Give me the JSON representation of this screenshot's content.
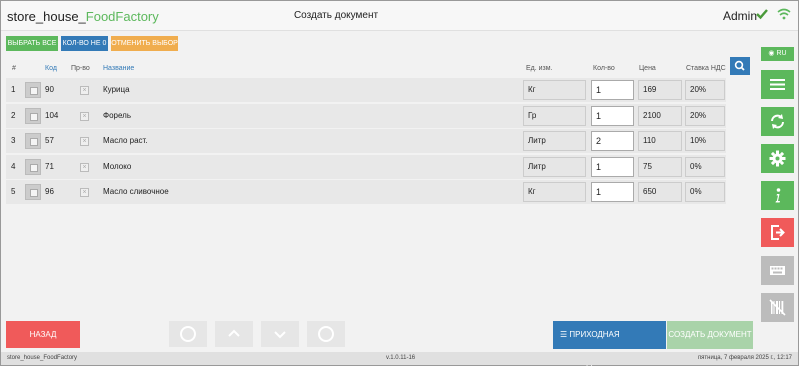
{
  "header": {
    "brand_prefix": "store_house_",
    "brand_suffix": "FoodFactory",
    "title": "Создать документ",
    "user": "Admin"
  },
  "toolbar": {
    "select_all": "ВЫБРАТЬ ВСЕ",
    "qty_zero": "КОЛ-ВО НЕ 0",
    "cancel_selection": "ОТМЕНИТЬ ВЫБОР"
  },
  "table": {
    "headers": {
      "num": "#",
      "code": "Код",
      "producer": "Пр-во",
      "name": "Название",
      "unit": "Ед. изм.",
      "qty": "Кол-во",
      "price": "Цена",
      "vat": "Ставка НДС"
    },
    "rows": [
      {
        "num": "1",
        "code": "90",
        "name": "Курица",
        "unit": "Кг",
        "qty": "1",
        "price": "169",
        "vat": "20%"
      },
      {
        "num": "2",
        "code": "104",
        "name": "Форель",
        "unit": "Гр",
        "qty": "1",
        "price": "2100",
        "vat": "20%"
      },
      {
        "num": "3",
        "code": "57",
        "name": "Масло раст.",
        "unit": "Литр",
        "qty": "2",
        "price": "110",
        "vat": "10%"
      },
      {
        "num": "4",
        "code": "71",
        "name": "Молоко",
        "unit": "Литр",
        "qty": "1",
        "price": "75",
        "vat": "0%"
      },
      {
        "num": "5",
        "code": "96",
        "name": "Масло сливочное",
        "unit": "Кг",
        "qty": "1",
        "price": "650",
        "vat": "0%"
      }
    ]
  },
  "sidebar": {
    "lang": "RU",
    "buttons": [
      {
        "name": "menu-button",
        "icon": "menu-icon",
        "color": "#5cb85c"
      },
      {
        "name": "sync-button",
        "icon": "sync-icon",
        "color": "#5cb85c"
      },
      {
        "name": "settings-button",
        "icon": "gear-icon",
        "color": "#5cb85c"
      },
      {
        "name": "info-button",
        "icon": "info-icon",
        "color": "#5cb85c"
      },
      {
        "name": "logout-button",
        "icon": "logout-icon",
        "color": "#f05a5a"
      },
      {
        "name": "keyboard-button",
        "icon": "keyboard-icon",
        "color": "#bcbcbc"
      },
      {
        "name": "barcode-button",
        "icon": "barcode-off-icon",
        "color": "#bcbcbc"
      }
    ]
  },
  "bottom": {
    "back": "НАЗАД",
    "invoice": "ПРИХОДНАЯ НАКЛАДНАЯ",
    "create": "СОЗДАТЬ ДОКУМЕНТ"
  },
  "footer": {
    "app": "store_house_FoodFactory",
    "version": "v.1.0.11-16",
    "datetime": "пятница, 7 февраля 2025 г., 12:17"
  },
  "colors": {
    "green": "#5cb85c",
    "blue": "#337ab7",
    "orange": "#f0ad4e",
    "red": "#f05a5a"
  }
}
